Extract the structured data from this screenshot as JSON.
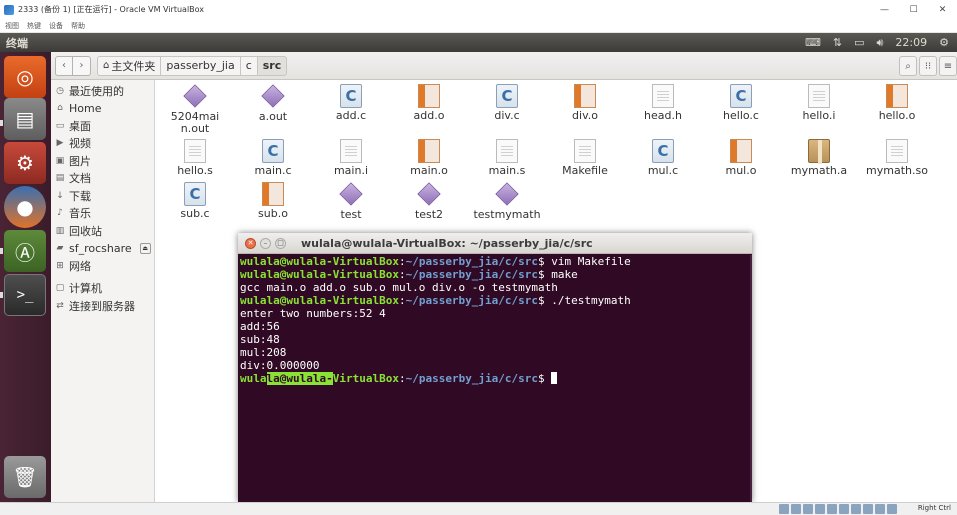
{
  "vbox": {
    "title": "2333 (备份 1) [正在运行] - Oracle VM VirtualBox",
    "menu": [
      "视图",
      "热键",
      "设备",
      "帮助"
    ],
    "host_key": "Right Ctrl"
  },
  "panel": {
    "app_name": "终端",
    "clock": "22:09"
  },
  "launcher": {
    "items": [
      "ubuntu-dash-icon",
      "files-icon",
      "settings-icon",
      "firefox-icon",
      "software-center-icon",
      "terminal-icon",
      "trash-icon"
    ]
  },
  "filemanager": {
    "breadcrumbs": [
      "主文件夹",
      "passerby_jia",
      "c",
      "src"
    ],
    "sidebar": [
      {
        "label": "最近使用的",
        "icon": "clock-icon"
      },
      {
        "label": "Home",
        "icon": "home-icon"
      },
      {
        "label": "桌面",
        "icon": "desktop-icon"
      },
      {
        "label": "视频",
        "icon": "video-icon"
      },
      {
        "label": "图片",
        "icon": "picture-icon"
      },
      {
        "label": "文档",
        "icon": "document-icon"
      },
      {
        "label": "下载",
        "icon": "download-icon"
      },
      {
        "label": "音乐",
        "icon": "music-icon"
      },
      {
        "label": "回收站",
        "icon": "trash-icon"
      },
      {
        "label": "sf_rocshare",
        "icon": "folder-icon"
      },
      {
        "label": "网络",
        "icon": "network-icon"
      },
      {
        "label": "计算机",
        "icon": "computer-icon"
      },
      {
        "label": "连接到服务器",
        "icon": "server-icon"
      }
    ],
    "files": [
      {
        "name": "5204main.out",
        "type": "exe"
      },
      {
        "name": "a.out",
        "type": "exe"
      },
      {
        "name": "add.c",
        "type": "csrc"
      },
      {
        "name": "add.o",
        "type": "obj"
      },
      {
        "name": "div.c",
        "type": "csrc"
      },
      {
        "name": "div.o",
        "type": "obj"
      },
      {
        "name": "head.h",
        "type": "doc"
      },
      {
        "name": "hello.c",
        "type": "csrc"
      },
      {
        "name": "hello.i",
        "type": "doc"
      },
      {
        "name": "hello.o",
        "type": "obj"
      },
      {
        "name": "hello.s",
        "type": "doc"
      },
      {
        "name": "main.c",
        "type": "csrc"
      },
      {
        "name": "main.i",
        "type": "doc"
      },
      {
        "name": "main.o",
        "type": "obj"
      },
      {
        "name": "main.s",
        "type": "doc"
      },
      {
        "name": "Makefile",
        "type": "doc"
      },
      {
        "name": "mul.c",
        "type": "csrc"
      },
      {
        "name": "mul.o",
        "type": "obj"
      },
      {
        "name": "mymath.a",
        "type": "box"
      },
      {
        "name": "mymath.so",
        "type": "doc"
      },
      {
        "name": "sub.c",
        "type": "csrc"
      },
      {
        "name": "sub.o",
        "type": "obj"
      },
      {
        "name": "test",
        "type": "exe"
      },
      {
        "name": "test2",
        "type": "exe"
      },
      {
        "name": "testmymath",
        "type": "exe"
      }
    ]
  },
  "terminal": {
    "title": "wulala@wulala-VirtualBox: ~/passerby_jia/c/src",
    "user_host": "wulala@wulala-VirtualBox",
    "path": "~/passerby_jia/c/src",
    "lines": [
      {
        "prompt": true,
        "cmd": " vim Makefile"
      },
      {
        "prompt": true,
        "cmd": " make"
      },
      {
        "prompt": false,
        "text": "gcc main.o add.o sub.o mul.o div.o -o testmymath"
      },
      {
        "prompt": true,
        "cmd": " ./testmymath"
      },
      {
        "prompt": false,
        "text": "enter two numbers:52 4"
      },
      {
        "prompt": false,
        "text": "add:56"
      },
      {
        "prompt": false,
        "text": "sub:48"
      },
      {
        "prompt": false,
        "text": "mul:208"
      },
      {
        "prompt": false,
        "text": "div:0.000000"
      }
    ],
    "last_prompt": {
      "pre": "wula",
      "highlight": "la@wulala-",
      "post": "VirtualBox"
    }
  }
}
